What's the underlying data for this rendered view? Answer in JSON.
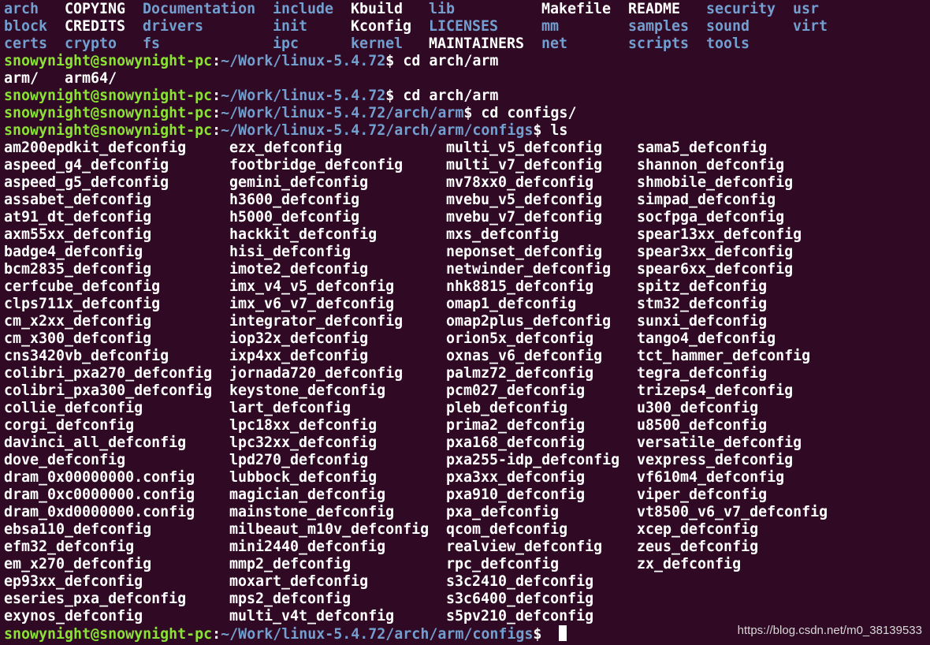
{
  "colors": {
    "background": "#300a24",
    "directory": "#729fcf",
    "plain_file": "#ffffff",
    "prompt_user": "#8ae234",
    "prompt_path": "#729fcf",
    "cursor": "#ffffff"
  },
  "prompt": {
    "user_host": "snowynight@snowynight-pc",
    "separator": ":",
    "symbol": "$"
  },
  "root_listing": {
    "rows": [
      [
        {
          "name": "arch",
          "kind": "dir"
        },
        {
          "name": "COPYING",
          "kind": "file"
        },
        {
          "name": "Documentation",
          "kind": "dir"
        },
        {
          "name": "include",
          "kind": "dir"
        },
        {
          "name": "Kbuild",
          "kind": "file"
        },
        {
          "name": "lib",
          "kind": "dir"
        },
        {
          "name": "Makefile",
          "kind": "file"
        },
        {
          "name": "README",
          "kind": "file"
        },
        {
          "name": "security",
          "kind": "dir"
        },
        {
          "name": "usr",
          "kind": "dir"
        }
      ],
      [
        {
          "name": "block",
          "kind": "dir"
        },
        {
          "name": "CREDITS",
          "kind": "file"
        },
        {
          "name": "drivers",
          "kind": "dir"
        },
        {
          "name": "init",
          "kind": "dir"
        },
        {
          "name": "Kconfig",
          "kind": "file"
        },
        {
          "name": "LICENSES",
          "kind": "dir"
        },
        {
          "name": "mm",
          "kind": "dir"
        },
        {
          "name": "samples",
          "kind": "dir"
        },
        {
          "name": "sound",
          "kind": "dir"
        },
        {
          "name": "virt",
          "kind": "dir"
        }
      ],
      [
        {
          "name": "certs",
          "kind": "dir"
        },
        {
          "name": "crypto",
          "kind": "dir"
        },
        {
          "name": "fs",
          "kind": "dir"
        },
        {
          "name": "ipc",
          "kind": "dir"
        },
        {
          "name": "kernel",
          "kind": "dir"
        },
        {
          "name": "MAINTAINERS",
          "kind": "file"
        },
        {
          "name": "net",
          "kind": "dir"
        },
        {
          "name": "scripts",
          "kind": "dir"
        },
        {
          "name": "tools",
          "kind": "dir"
        },
        null
      ]
    ]
  },
  "session": [
    {
      "path": "~/Work/linux-5.4.72",
      "command": " cd arch/arm"
    },
    {
      "output": "arm/   arm64/"
    },
    {
      "path": "~/Work/linux-5.4.72",
      "command": " cd arch/arm"
    },
    {
      "path": "~/Work/linux-5.4.72/arch/arm",
      "command": " cd configs/"
    },
    {
      "path": "~/Work/linux-5.4.72/arch/arm/configs",
      "command": " ls"
    }
  ],
  "ls_columns": [
    [
      "am200epdkit_defconfig",
      "aspeed_g4_defconfig",
      "aspeed_g5_defconfig",
      "assabet_defconfig",
      "at91_dt_defconfig",
      "axm55xx_defconfig",
      "badge4_defconfig",
      "bcm2835_defconfig",
      "cerfcube_defconfig",
      "clps711x_defconfig",
      "cm_x2xx_defconfig",
      "cm_x300_defconfig",
      "cns3420vb_defconfig",
      "colibri_pxa270_defconfig",
      "colibri_pxa300_defconfig",
      "collie_defconfig",
      "corgi_defconfig",
      "davinci_all_defconfig",
      "dove_defconfig",
      "dram_0x00000000.config",
      "dram_0xc0000000.config",
      "dram_0xd0000000.config",
      "ebsa110_defconfig",
      "efm32_defconfig",
      "em_x270_defconfig",
      "ep93xx_defconfig",
      "eseries_pxa_defconfig",
      "exynos_defconfig"
    ],
    [
      "ezx_defconfig",
      "footbridge_defconfig",
      "gemini_defconfig",
      "h3600_defconfig",
      "h5000_defconfig",
      "hackkit_defconfig",
      "hisi_defconfig",
      "imote2_defconfig",
      "imx_v4_v5_defconfig",
      "imx_v6_v7_defconfig",
      "integrator_defconfig",
      "iop32x_defconfig",
      "ixp4xx_defconfig",
      "jornada720_defconfig",
      "keystone_defconfig",
      "lart_defconfig",
      "lpc18xx_defconfig",
      "lpc32xx_defconfig",
      "lpd270_defconfig",
      "lubbock_defconfig",
      "magician_defconfig",
      "mainstone_defconfig",
      "milbeaut_m10v_defconfig",
      "mini2440_defconfig",
      "mmp2_defconfig",
      "moxart_defconfig",
      "mps2_defconfig",
      "multi_v4t_defconfig"
    ],
    [
      "multi_v5_defconfig",
      "multi_v7_defconfig",
      "mv78xx0_defconfig",
      "mvebu_v5_defconfig",
      "mvebu_v7_defconfig",
      "mxs_defconfig",
      "neponset_defconfig",
      "netwinder_defconfig",
      "nhk8815_defconfig",
      "omap1_defconfig",
      "omap2plus_defconfig",
      "orion5x_defconfig",
      "oxnas_v6_defconfig",
      "palmz72_defconfig",
      "pcm027_defconfig",
      "pleb_defconfig",
      "prima2_defconfig",
      "pxa168_defconfig",
      "pxa255-idp_defconfig",
      "pxa3xx_defconfig",
      "pxa910_defconfig",
      "pxa_defconfig",
      "qcom_defconfig",
      "realview_defconfig",
      "rpc_defconfig",
      "s3c2410_defconfig",
      "s3c6400_defconfig",
      "s5pv210_defconfig"
    ],
    [
      "sama5_defconfig",
      "shannon_defconfig",
      "shmobile_defconfig",
      "simpad_defconfig",
      "socfpga_defconfig",
      "spear13xx_defconfig",
      "spear3xx_defconfig",
      "spear6xx_defconfig",
      "spitz_defconfig",
      "stm32_defconfig",
      "sunxi_defconfig",
      "tango4_defconfig",
      "tct_hammer_defconfig",
      "tegra_defconfig",
      "trizeps4_defconfig",
      "u300_defconfig",
      "u8500_defconfig",
      "versatile_defconfig",
      "vexpress_defconfig",
      "vf610m4_defconfig",
      "viper_defconfig",
      "vt8500_v6_v7_defconfig",
      "xcep_defconfig",
      "zeus_defconfig",
      "zx_defconfig"
    ]
  ],
  "final_prompt": {
    "path": "~/Work/linux-5.4.72/arch/arm/configs",
    "command": " "
  },
  "watermark": "https://blog.csdn.net/m0_38139533"
}
